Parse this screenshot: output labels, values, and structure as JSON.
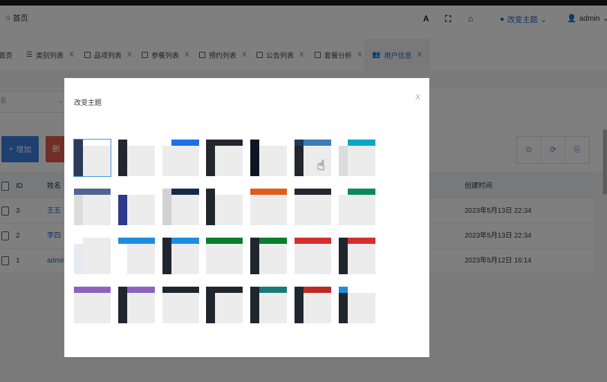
{
  "header": {
    "home_label": "首页",
    "font_btn": "A",
    "fullscreen_btn": "⛶",
    "home_btn": "⌂",
    "theme_label": "改变主题",
    "user_label": "admin"
  },
  "tabs": [
    {
      "label": "首页",
      "close": ""
    },
    {
      "label": "类别列表",
      "close": "X"
    },
    {
      "label": "品项列表",
      "close": "X"
    },
    {
      "label": "参餐列表",
      "close": "X"
    },
    {
      "label": "预约列表",
      "close": "X"
    },
    {
      "label": "公告列表",
      "close": "X"
    },
    {
      "label": "套餐分析",
      "close": "X"
    },
    {
      "label": "用户信息",
      "close": "X"
    }
  ],
  "filter": {
    "select_label": "名"
  },
  "toolbar": {
    "add_label": "增加",
    "del_label": "删",
    "tool1": "⊙",
    "tool2": "⟳",
    "tool3": "⎘"
  },
  "table": {
    "headers": {
      "id": "ID",
      "name": "姓名",
      "created": "创建时间"
    },
    "rows": [
      {
        "id": "3",
        "name": "王五",
        "created": "2023年5月13日 22:34"
      },
      {
        "id": "2",
        "name": "李四",
        "created": "2023年5月13日 22:34"
      },
      {
        "id": "1",
        "name": "admin",
        "created": "2023年5月12日 16:14"
      }
    ]
  },
  "modal": {
    "title": "改变主题",
    "close": "X",
    "themes": [
      {
        "top": "#ffffff",
        "side": "#2c3a59",
        "logo": "#2c3a59",
        "selected": true
      },
      {
        "top": "#ffffff",
        "side": "#23262e",
        "logo": "#23262e"
      },
      {
        "top": "#1e6fe8",
        "side": "#ececec",
        "logo": "#ffffff"
      },
      {
        "top": "#23262e",
        "side": "#23262e",
        "logo": "#23262e"
      },
      {
        "top": "#ffffff",
        "side": "#0c1622",
        "logo": "#0c1622"
      },
      {
        "top": "#3a7bb8",
        "side": "#23262e",
        "logo": "#1b3a5c"
      },
      {
        "top": "#0aa5c5",
        "side": "#dcdcdc",
        "logo": "#ffffff"
      },
      {
        "top": "#4f6491",
        "side": "#dcdcdc",
        "logo": "#4f6491"
      },
      {
        "top": "#ffffff",
        "side": "#2c3a8a",
        "logo": "#ffffff"
      },
      {
        "top": "#132a4a",
        "side": "#d2d2d2",
        "logo": "#d2d2d2"
      },
      {
        "top": "#ffffff",
        "side": "#20262e",
        "logo": "#20262e"
      },
      {
        "top": "#e05c1c",
        "side": "#ececec",
        "logo": "#e05c1c"
      },
      {
        "top": "#23262e",
        "side": "#ececec",
        "logo": "#23262e"
      },
      {
        "top": "#078a5f",
        "side": "#ececec",
        "logo": "#ffffff"
      },
      {
        "top": "#ececec",
        "side": "#e6ebf2",
        "logo": "#ffffff"
      },
      {
        "top": "#1e8de0",
        "side": "#ffffff",
        "logo": "#1e8de0"
      },
      {
        "top": "#1e8de0",
        "side": "#20262e",
        "logo": "#20262e"
      },
      {
        "top": "#087e2f",
        "side": "#ececec",
        "logo": "#087e2f"
      },
      {
        "top": "#087e2f",
        "side": "#20262e",
        "logo": "#20262e"
      },
      {
        "top": "#d42e2e",
        "side": "#ececec",
        "logo": "#d42e2e"
      },
      {
        "top": "#d42e2e",
        "side": "#20262e",
        "logo": "#20262e"
      },
      {
        "top": "#8b62bd",
        "side": "#ececec",
        "logo": "#8b62bd"
      },
      {
        "top": "#8b62bd",
        "side": "#20262e",
        "logo": "#20262e"
      },
      {
        "top": "#20262e",
        "side": "#ececec",
        "logo": "#20262e"
      },
      {
        "top": "#20262e",
        "side": "#20262e",
        "logo": "#20262e"
      },
      {
        "top": "#1a7a7a",
        "side": "#20262e",
        "logo": "#20262e"
      },
      {
        "top": "#bb2a23",
        "side": "#20262e",
        "logo": "#20262e"
      },
      {
        "top": "#ffffff",
        "side": "#20262e",
        "logo": "#1e8de0"
      }
    ]
  }
}
